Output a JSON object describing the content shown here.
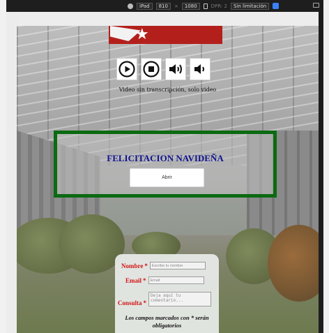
{
  "devtools": {
    "device": "iPad",
    "width": "810",
    "times": "×",
    "height": "1080",
    "dpr_label": "DPR: 2",
    "throttling": "Sin limitación"
  },
  "page": {
    "caption": "Video sin transcripción, solo video",
    "greeting": {
      "title": "FELICITACION NAVIDEÑA",
      "open_button": "Abrir"
    },
    "media_controls": [
      "play-icon",
      "stop-icon",
      "volume-up-icon",
      "volume-down-icon"
    ],
    "form": {
      "name_label": "Nombre",
      "name_placeholder": "Escribe tu nombre",
      "email_label": "Email",
      "email_placeholder": "Email",
      "query_label": "Consulta",
      "query_placeholder": "Deja aquí tu comentario...",
      "required_mark": "*",
      "note": "Los campos marcados con * serán obligatorios"
    }
  },
  "colors": {
    "greeting_border": "#0b6a12",
    "greeting_title": "#10138f",
    "label_red": "#d11515",
    "card_red": "#b3201c"
  }
}
